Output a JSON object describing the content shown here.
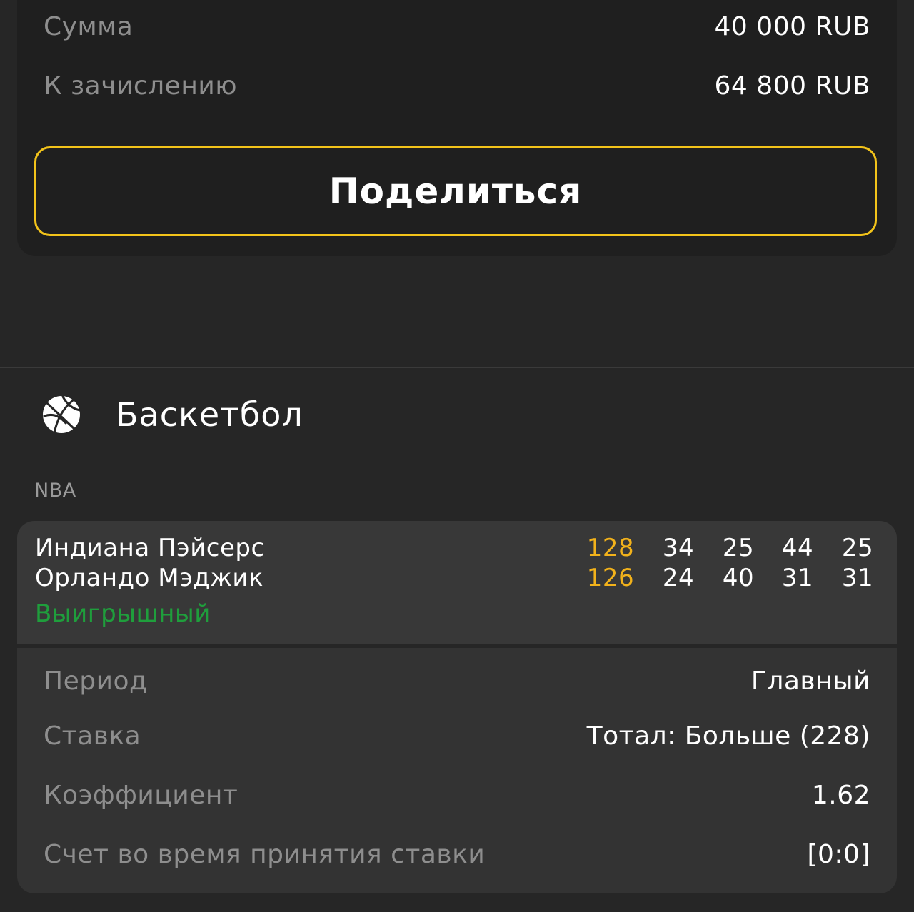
{
  "summary": {
    "amount_label": "Сумма",
    "amount_value": "40 000 RUB",
    "payout_label": "К зачислению",
    "payout_value": "64 800 RUB",
    "share_button": "Поделиться"
  },
  "sport": {
    "icon": "basketball-icon",
    "title": "Баскетбол",
    "league": "NBA"
  },
  "match": {
    "teams": [
      {
        "name": "Индиана Пэйсерс",
        "total": "128",
        "quarters": [
          "34",
          "25",
          "44",
          "25"
        ]
      },
      {
        "name": "Орландо Мэджик",
        "total": "126",
        "quarters": [
          "24",
          "40",
          "31",
          "31"
        ]
      }
    ],
    "status": "Выигрышный"
  },
  "details": {
    "period_label": "Период",
    "period_value": "Главный",
    "bet_label": "Ставка",
    "bet_value": "Тотал: Больше (228)",
    "odds_label": "Коэффициент",
    "odds_value": "1.62",
    "score_label": "Счет во время принятия ставки",
    "score_value": "[0:0]"
  },
  "colors": {
    "accent": "#f2c31a",
    "total_score": "#f2b21b",
    "win_status": "#1f9e3c",
    "label_gray": "#8e8e8e"
  }
}
